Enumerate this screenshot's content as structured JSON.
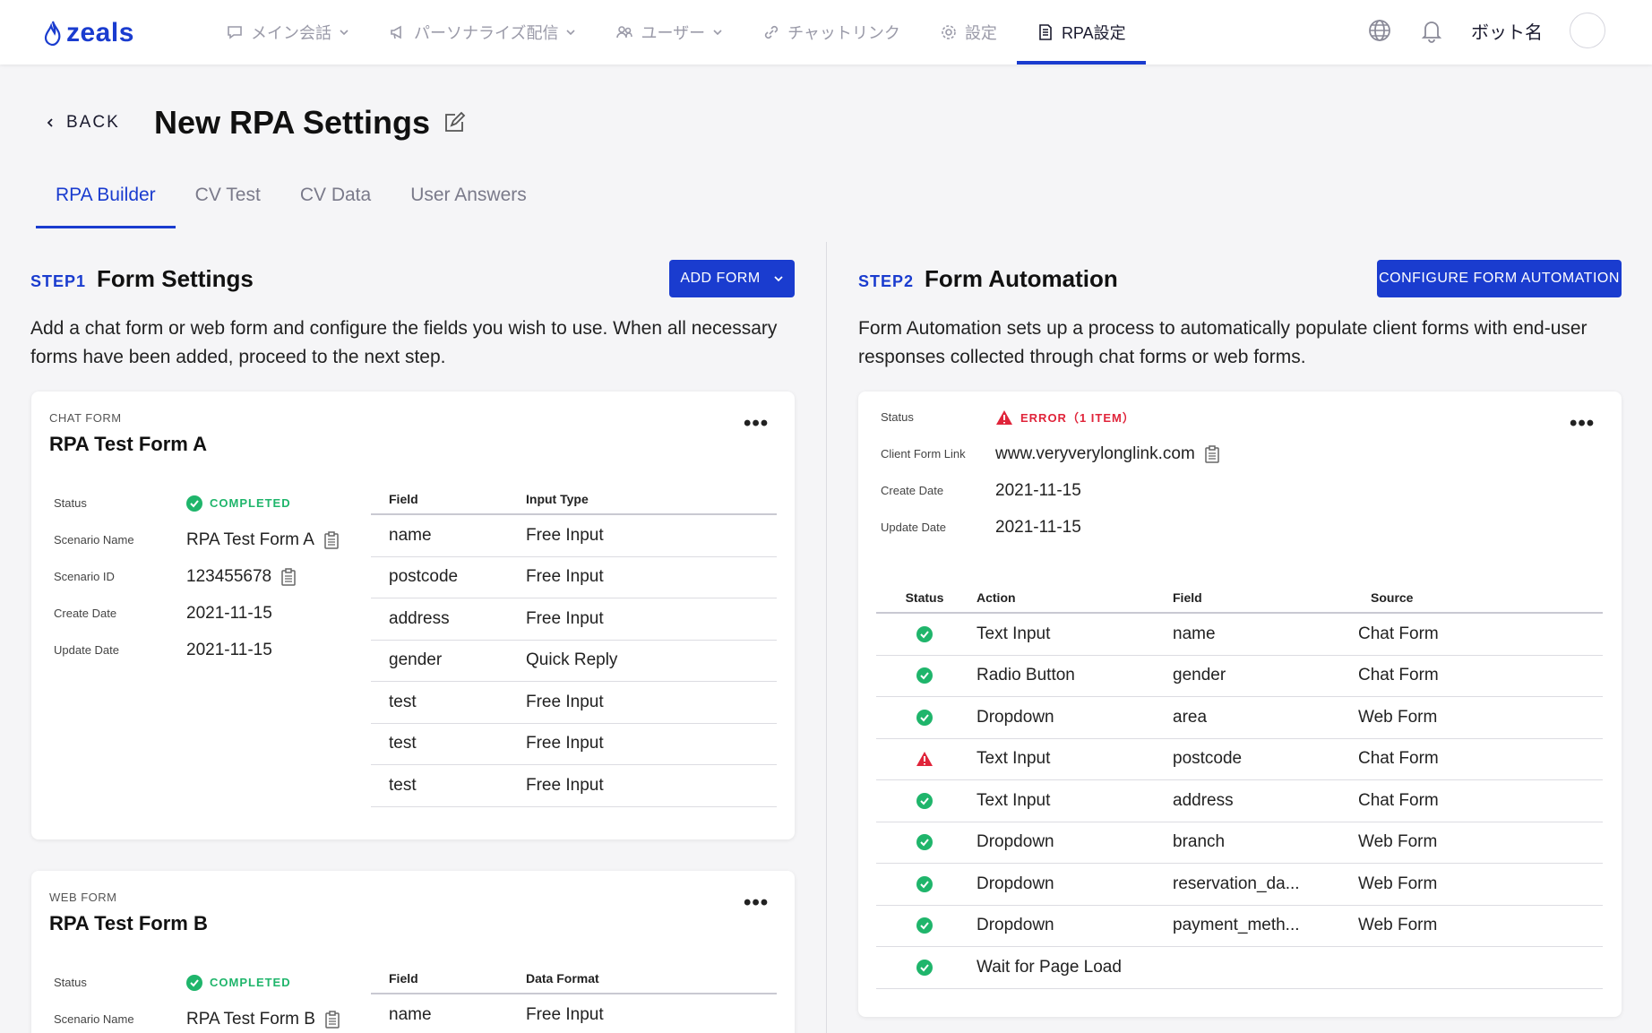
{
  "brand": {
    "logo_text": "zeals",
    "accent": "#1a3ccf"
  },
  "nav": {
    "items": [
      {
        "label": "メイン会話",
        "icon": "chat-icon",
        "has_dropdown": true
      },
      {
        "label": "パーソナライズ配信",
        "icon": "megaphone-icon",
        "has_dropdown": true
      },
      {
        "label": "ユーザー",
        "icon": "users-icon",
        "has_dropdown": true
      },
      {
        "label": "チャットリンク",
        "icon": "link-icon",
        "has_dropdown": false
      },
      {
        "label": "設定",
        "icon": "gear-icon",
        "has_dropdown": false
      },
      {
        "label": "RPA設定",
        "icon": "document-icon",
        "has_dropdown": false,
        "active": true
      }
    ],
    "bot_name": "ボット名"
  },
  "header": {
    "back_label": "BACK",
    "title": "New RPA Settings"
  },
  "tabs": [
    {
      "label": "RPA Builder",
      "active": true
    },
    {
      "label": "CV Test"
    },
    {
      "label": "CV Data"
    },
    {
      "label": "User Answers"
    }
  ],
  "step1": {
    "step_label": "STEP1",
    "title": "Form Settings",
    "button_label": "ADD FORM",
    "description": "Add a chat form or web form and configure the fields you wish to use. When all necessary forms have been added, proceed to the next step.",
    "forms": [
      {
        "kind": "CHAT FORM",
        "name": "RPA Test Form A",
        "meta_labels": {
          "status": "Status",
          "scenario_name": "Scenario Name",
          "scenario_id": "Scenario ID",
          "create_date": "Create Date",
          "update_date": "Update Date"
        },
        "status": "COMPLETED",
        "scenario_name": "RPA Test Form A",
        "scenario_id": "123455678",
        "create_date": "2021-11-15",
        "update_date": "2021-11-15",
        "table_headers": {
          "field": "Field",
          "type": "Input Type"
        },
        "rows": [
          {
            "field": "name",
            "type": "Free Input"
          },
          {
            "field": "postcode",
            "type": "Free Input"
          },
          {
            "field": "address",
            "type": "Free Input"
          },
          {
            "field": "gender",
            "type": "Quick Reply"
          },
          {
            "field": "test",
            "type": "Free Input"
          },
          {
            "field": "test",
            "type": "Free Input"
          },
          {
            "field": "test",
            "type": "Free Input"
          }
        ]
      },
      {
        "kind": "WEB FORM",
        "name": "RPA Test Form B",
        "meta_labels": {
          "status": "Status",
          "scenario_name": "Scenario Name"
        },
        "status": "COMPLETED",
        "scenario_name": "RPA Test Form B",
        "table_headers": {
          "field": "Field",
          "type": "Data Format"
        },
        "rows": [
          {
            "field": "name",
            "type": "Free Input"
          }
        ]
      }
    ]
  },
  "step2": {
    "step_label": "STEP2",
    "title": "Form Automation",
    "button_label": "CONFIGURE FORM AUTOMATION",
    "description": "Form Automation sets up a process to automatically populate client forms with end-user responses collected through chat forms or web forms.",
    "meta_labels": {
      "status": "Status",
      "link": "Client Form Link",
      "create_date": "Create Date",
      "update_date": "Update Date"
    },
    "status": "ERROR（1 ITEM）",
    "client_form_link": "www.veryverylonglink.com",
    "create_date": "2021-11-15",
    "update_date": "2021-11-15",
    "table_headers": {
      "status": "Status",
      "action": "Action",
      "field": "Field",
      "source": "Source"
    },
    "rows": [
      {
        "status": "ok",
        "action": "Text Input",
        "field": "name",
        "source": "Chat Form"
      },
      {
        "status": "ok",
        "action": "Radio Button",
        "field": "gender",
        "source": "Chat Form"
      },
      {
        "status": "ok",
        "action": "Dropdown",
        "field": "area",
        "source": "Web Form"
      },
      {
        "status": "error",
        "action": "Text Input",
        "field": "postcode",
        "source": "Chat Form"
      },
      {
        "status": "ok",
        "action": "Text Input",
        "field": "address",
        "source": "Chat Form"
      },
      {
        "status": "ok",
        "action": "Dropdown",
        "field": "branch",
        "source": "Web Form"
      },
      {
        "status": "ok",
        "action": "Dropdown",
        "field": "reservation_da...",
        "source": "Web Form"
      },
      {
        "status": "ok",
        "action": "Dropdown",
        "field": "payment_meth...",
        "source": "Web Form"
      },
      {
        "status": "ok",
        "action": "Wait for Page Load",
        "field": "",
        "source": ""
      }
    ]
  },
  "colors": {
    "success": "#1fb56b",
    "error": "#e0243a",
    "primary": "#1a3ccf"
  }
}
